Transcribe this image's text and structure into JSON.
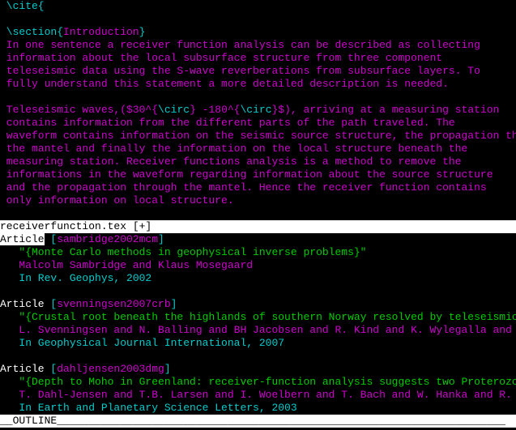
{
  "top": {
    "line1_a": " \\cite{",
    "blank1": "",
    "sec_a": " \\section{",
    "sec_b": "Introduction",
    "sec_c": "}",
    "p1_l1": " In one sentence a receiver function analysis can be described as collecting",
    "p1_l2": " information about the local subsurface structure from three component",
    "p1_l3": " teleseismic data using the S-wave reverberations from subsurface layers. To",
    "p1_l4": " fully understand this statement a more detailed description is needed.",
    "blank2": "",
    "p2_l1a": " Teleseismic waves,($30^{",
    "p2_l1b": "\\circ",
    "p2_l1c": "} -180^{",
    "p2_l1d": "\\circ",
    "p2_l1e": "}$), arriving at a measuring station",
    "p2_l2": " contains information from the different parts of the path traveled. The",
    "p2_l3": " waveform contains information on the seismic source structure, the propagation through",
    "p2_l4": " the mantel and finally the information on the local structure beneath the",
    "p2_l5": " measuring station. Receiver functions analysis is a method to remove the",
    "p2_l6": " informations in the waveform regarding information about the source structure",
    "p2_l7": " and the propagation through the mantel. Hence the receiver function contains",
    "p2_l8": " only information on local structure.",
    "blank3": ""
  },
  "status": "receiverfunction.tex [+]                                                        ",
  "articles": [
    {
      "kw": "Article",
      "key_a": " [",
      "key_b": "sambridge2002mcm",
      "key_c": "]",
      "title": "   \"{Monte Carlo methods in geophysical inverse problems}\"",
      "authors": "   Malcolm Sambridge and Klaus Mosegaard",
      "pub": "   In Rev. Geophys, 2002"
    },
    {
      "kw": "Article",
      "key_a": " [",
      "key_b": "svenningsen2007crb",
      "key_c": "]",
      "title": "   \"{Crustal root beneath the highlands of southern Norway resolved by teleseismic receiver",
      "authors": "   L. Svenningsen and N. Balling and BH Jacobsen and R. Kind and K. Wylegalla and J. Schwei",
      "pub": "   In Geophysical Journal International, 2007"
    },
    {
      "kw": "Article",
      "key_a": " [",
      "key_b": "dahljensen2003dmg",
      "key_c": "]",
      "title": "   \"{Depth to Moho in Greenland: receiver-function analysis suggests two Proterozoic blocks",
      "authors": "   T. Dahl-Jensen and T.B. Larsen and I. Woelbern and T. Bach and W. Hanka and R. Kind and ",
      "pub": "   In Earth and Planetary Science Letters, 2003"
    }
  ],
  "ruler": "__OUTLINE_______________________________________________________________________"
}
